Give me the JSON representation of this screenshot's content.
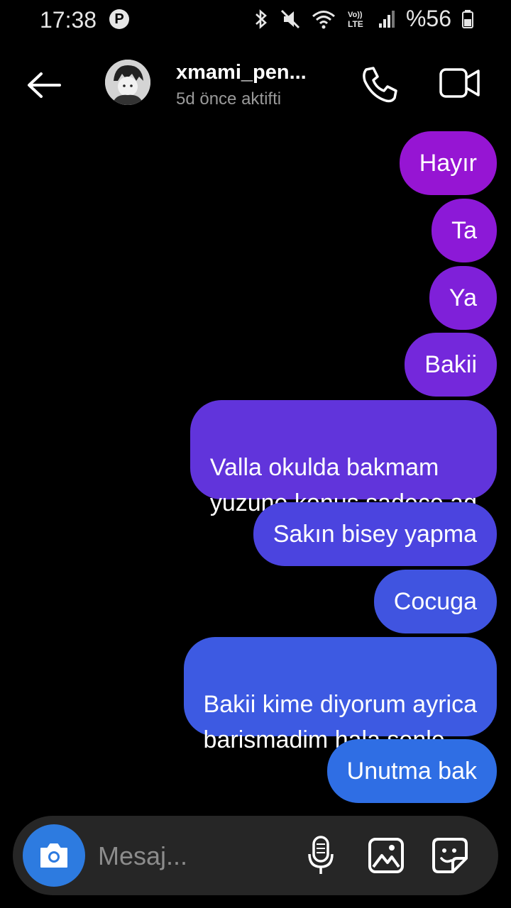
{
  "status": {
    "time": "17:38",
    "battery": "%56",
    "network": "LTE"
  },
  "header": {
    "name": "xmami_pen...",
    "status": "5d önce aktifti"
  },
  "messages": [
    {
      "text": "Hayır",
      "color": "#9615d3"
    },
    {
      "text": "Ta",
      "color": "#8c19d7"
    },
    {
      "text": "Ya",
      "color": "#7f20d9"
    },
    {
      "text": "Bakii",
      "color": "#7428db"
    },
    {
      "text": "Valla okulda bakmam\nyuzune konuş  sadece aq",
      "color": "#6134db"
    },
    {
      "text": "Sakın  bisey yapma",
      "color": "#4b44df"
    },
    {
      "text": "Cocuga",
      "color": "#4054e0"
    },
    {
      "text": "Bakii kime diyorum ayrica\nbarismadim hala senle",
      "color": "#3d5ae2"
    },
    {
      "text": "Unutma bak",
      "color": "#2f6ee4"
    }
  ],
  "composer": {
    "placeholder": "Mesaj..."
  }
}
